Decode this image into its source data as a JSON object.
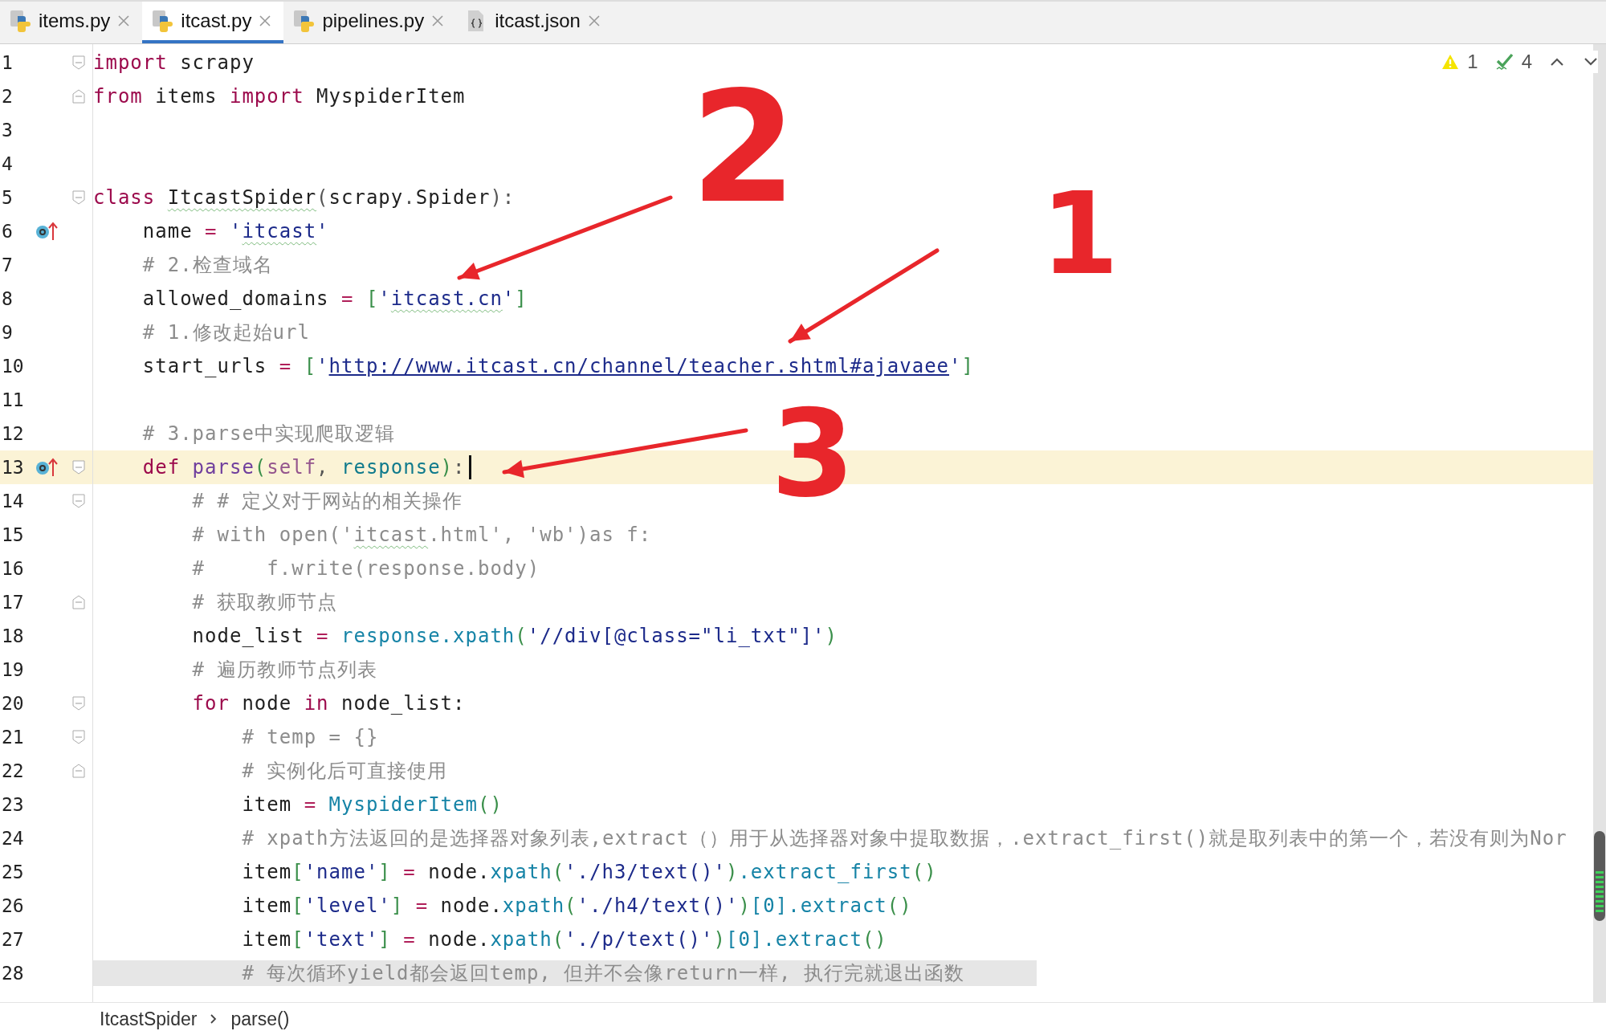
{
  "tabs": [
    {
      "label": "items.py",
      "kind": "python",
      "selected": false
    },
    {
      "label": "itcast.py",
      "kind": "python",
      "selected": true
    },
    {
      "label": "pipelines.py",
      "kind": "python",
      "selected": false
    },
    {
      "label": "itcast.json",
      "kind": "json",
      "selected": false
    }
  ],
  "inspections": {
    "warnings": "1",
    "checks": "4"
  },
  "lines": [
    {
      "number": "1",
      "gutter_icons": [
        {
          "kind": "fold-start"
        }
      ],
      "current": false,
      "tokens": [
        {
          "kind": "kw",
          "text": "import"
        },
        {
          "kind": "txt",
          "text": " scrapy"
        }
      ]
    },
    {
      "number": "2",
      "gutter_icons": [
        {
          "kind": "fold-end"
        }
      ],
      "current": false,
      "tokens": [
        {
          "kind": "kw",
          "text": "from"
        },
        {
          "kind": "txt",
          "text": " items "
        },
        {
          "kind": "kw",
          "text": "import"
        },
        {
          "kind": "txt",
          "text": " MyspiderItem"
        }
      ]
    },
    {
      "number": "3",
      "current": false
    },
    {
      "number": "4",
      "current": false
    },
    {
      "number": "5",
      "gutter_icons": [
        {
          "kind": "fold-start"
        }
      ],
      "current": false,
      "tokens": [
        {
          "kind": "kw",
          "text": "class "
        },
        {
          "kind": "txt-typo",
          "text": "ItcastSpider"
        },
        {
          "kind": "punct",
          "text": "("
        },
        {
          "kind": "txt",
          "text": "scrapy"
        },
        {
          "kind": "punct",
          "text": "."
        },
        {
          "kind": "txt",
          "text": "Spider"
        },
        {
          "kind": "punct",
          "text": "):"
        }
      ]
    },
    {
      "number": "6",
      "gutter_icons": [
        {
          "kind": "override"
        }
      ],
      "current": false,
      "tokens": [
        {
          "kind": "txt",
          "text": "    name"
        },
        {
          "kind": "op",
          "text": " = "
        },
        {
          "kind": "str",
          "text": "'"
        },
        {
          "kind": "str-typo",
          "text": "itcast"
        },
        {
          "kind": "str",
          "text": "'"
        }
      ]
    },
    {
      "number": "7",
      "current": false,
      "tokens": [
        {
          "kind": "cm",
          "text": "    # 2.检查域名"
        }
      ]
    },
    {
      "number": "8",
      "current": false,
      "tokens": [
        {
          "kind": "txt",
          "text": "    allowed_domains"
        },
        {
          "kind": "op",
          "text": " = "
        },
        {
          "kind": "br",
          "text": "["
        },
        {
          "kind": "str",
          "text": "'"
        },
        {
          "kind": "str-typo",
          "text": "itcast.cn"
        },
        {
          "kind": "str",
          "text": "'"
        },
        {
          "kind": "br",
          "text": "]"
        }
      ]
    },
    {
      "number": "9",
      "current": false,
      "tokens": [
        {
          "kind": "cm",
          "text": "    # 1.修改起始url"
        }
      ]
    },
    {
      "number": "10",
      "current": false,
      "tokens": [
        {
          "kind": "txt",
          "text": "    start_urls"
        },
        {
          "kind": "op",
          "text": " = "
        },
        {
          "kind": "br",
          "text": "["
        },
        {
          "kind": "str",
          "text": "'"
        },
        {
          "kind": "url",
          "text": "http://www.itcast.cn/channel/teacher.shtml#ajavaee"
        },
        {
          "kind": "str",
          "text": "'"
        },
        {
          "kind": "br",
          "text": "]"
        }
      ]
    },
    {
      "number": "11",
      "current": false
    },
    {
      "number": "12",
      "current": false,
      "tokens": [
        {
          "kind": "cm",
          "text": "    # 3.parse中实现爬取逻辑"
        }
      ]
    },
    {
      "number": "13",
      "gutter_icons": [
        {
          "kind": "override"
        },
        {
          "kind": "fold-start"
        }
      ],
      "current": true,
      "tokens": [
        {
          "kind": "kw",
          "text": "    def "
        },
        {
          "kind": "fn",
          "text": "parse"
        },
        {
          "kind": "br",
          "text": "("
        },
        {
          "kind": "self",
          "text": "self"
        },
        {
          "kind": "punct",
          "text": ", "
        },
        {
          "kind": "param",
          "text": "response"
        },
        {
          "kind": "br",
          "text": ")"
        },
        {
          "kind": "punct",
          "text": ":"
        }
      ]
    },
    {
      "number": "14",
      "gutter_icons": [
        {
          "kind": "fold-start"
        }
      ],
      "current": false,
      "tokens": [
        {
          "kind": "cm",
          "text": "        # # 定义对于网站的相关操作"
        }
      ]
    },
    {
      "number": "15",
      "current": false,
      "tokens": [
        {
          "kind": "cm",
          "text": "        # with open('"
        },
        {
          "kind": "cm-typo",
          "text": "itcast"
        },
        {
          "kind": "cm",
          "text": ".html', 'wb')as f:"
        }
      ]
    },
    {
      "number": "16",
      "current": false,
      "tokens": [
        {
          "kind": "cm",
          "text": "        #     f.write(response.body)"
        }
      ]
    },
    {
      "number": "17",
      "gutter_icons": [
        {
          "kind": "fold-end"
        }
      ],
      "current": false,
      "tokens": [
        {
          "kind": "cm",
          "text": "        # 获取教师节点"
        }
      ]
    },
    {
      "number": "18",
      "current": false,
      "tokens": [
        {
          "kind": "txt",
          "text": "        node_list"
        },
        {
          "kind": "op",
          "text": " = "
        },
        {
          "kind": "call",
          "text": "response.xpath"
        },
        {
          "kind": "br",
          "text": "("
        },
        {
          "kind": "str",
          "text": "'//div[@class=\"li_txt\"]'"
        },
        {
          "kind": "br",
          "text": ")"
        }
      ]
    },
    {
      "number": "19",
      "current": false,
      "tokens": [
        {
          "kind": "cm",
          "text": "        # 遍历教师节点列表"
        }
      ]
    },
    {
      "number": "20",
      "gutter_icons": [
        {
          "kind": "fold-start"
        }
      ],
      "current": false,
      "tokens": [
        {
          "kind": "kw",
          "text": "        for"
        },
        {
          "kind": "txt",
          "text": " node "
        },
        {
          "kind": "kw",
          "text": "in"
        },
        {
          "kind": "txt",
          "text": " node_list:"
        }
      ]
    },
    {
      "number": "21",
      "gutter_icons": [
        {
          "kind": "fold-start"
        }
      ],
      "current": false,
      "tokens": [
        {
          "kind": "cm",
          "text": "            # temp = {}"
        }
      ]
    },
    {
      "number": "22",
      "gutter_icons": [
        {
          "kind": "fold-end"
        }
      ],
      "current": false,
      "tokens": [
        {
          "kind": "cm",
          "text": "            # 实例化后可直接使用"
        }
      ]
    },
    {
      "number": "23",
      "current": false,
      "tokens": [
        {
          "kind": "txt",
          "text": "            item"
        },
        {
          "kind": "op",
          "text": " = "
        },
        {
          "kind": "call",
          "text": "MyspiderItem"
        },
        {
          "kind": "br",
          "text": "()"
        }
      ]
    },
    {
      "number": "24",
      "current": false,
      "tokens": [
        {
          "kind": "cm",
          "text": "            # xpath方法返回的是选择器对象列表,extract（）用于从选择器对象中提取数据，.extract_first()就是取列表中的第一个，若没有则为Nor"
        }
      ]
    },
    {
      "number": "25",
      "current": false,
      "tokens": [
        {
          "kind": "txt",
          "text": "            item"
        },
        {
          "kind": "br",
          "text": "["
        },
        {
          "kind": "str",
          "text": "'name'"
        },
        {
          "kind": "br",
          "text": "]"
        },
        {
          "kind": "op",
          "text": " = "
        },
        {
          "kind": "txt",
          "text": "node."
        },
        {
          "kind": "call",
          "text": "xpath"
        },
        {
          "kind": "br",
          "text": "("
        },
        {
          "kind": "str",
          "text": "'./h3/text()'"
        },
        {
          "kind": "br",
          "text": ")"
        },
        {
          "kind": "call",
          "text": ".extract_first"
        },
        {
          "kind": "br",
          "text": "()"
        }
      ]
    },
    {
      "number": "26",
      "current": false,
      "tokens": [
        {
          "kind": "txt",
          "text": "            item"
        },
        {
          "kind": "br",
          "text": "["
        },
        {
          "kind": "str",
          "text": "'level'"
        },
        {
          "kind": "br",
          "text": "]"
        },
        {
          "kind": "op",
          "text": " = "
        },
        {
          "kind": "txt",
          "text": "node."
        },
        {
          "kind": "call",
          "text": "xpath"
        },
        {
          "kind": "br",
          "text": "("
        },
        {
          "kind": "str",
          "text": "'./h4/text()'"
        },
        {
          "kind": "br",
          "text": ")"
        },
        {
          "kind": "call",
          "text": "[0].extract"
        },
        {
          "kind": "br",
          "text": "()"
        }
      ]
    },
    {
      "number": "27",
      "current": false,
      "tokens": [
        {
          "kind": "txt",
          "text": "            item"
        },
        {
          "kind": "br",
          "text": "["
        },
        {
          "kind": "str",
          "text": "'text'"
        },
        {
          "kind": "br",
          "text": "]"
        },
        {
          "kind": "op",
          "text": " = "
        },
        {
          "kind": "txt",
          "text": "node."
        },
        {
          "kind": "call",
          "text": "xpath"
        },
        {
          "kind": "br",
          "text": "("
        },
        {
          "kind": "str",
          "text": "'./p/text()'"
        },
        {
          "kind": "br",
          "text": ")"
        },
        {
          "kind": "call",
          "text": "[0].extract"
        },
        {
          "kind": "br",
          "text": "()"
        }
      ]
    },
    {
      "number": "28",
      "shaded": true,
      "current": false,
      "tokens": [
        {
          "kind": "cm",
          "text": "            # 每次循环yield都会返回temp, 但并不会像return一样, 执行完就退出函数"
        }
      ]
    }
  ],
  "breadcrumb": [
    "ItcastSpider",
    "parse()"
  ],
  "annotations": [
    {
      "text": "2",
      "kind": "digit"
    },
    {
      "text": "1",
      "kind": "digit"
    },
    {
      "text": "3",
      "kind": "digit"
    },
    {
      "kind": "arrow"
    },
    {
      "kind": "arrow"
    },
    {
      "kind": "arrow"
    }
  ]
}
